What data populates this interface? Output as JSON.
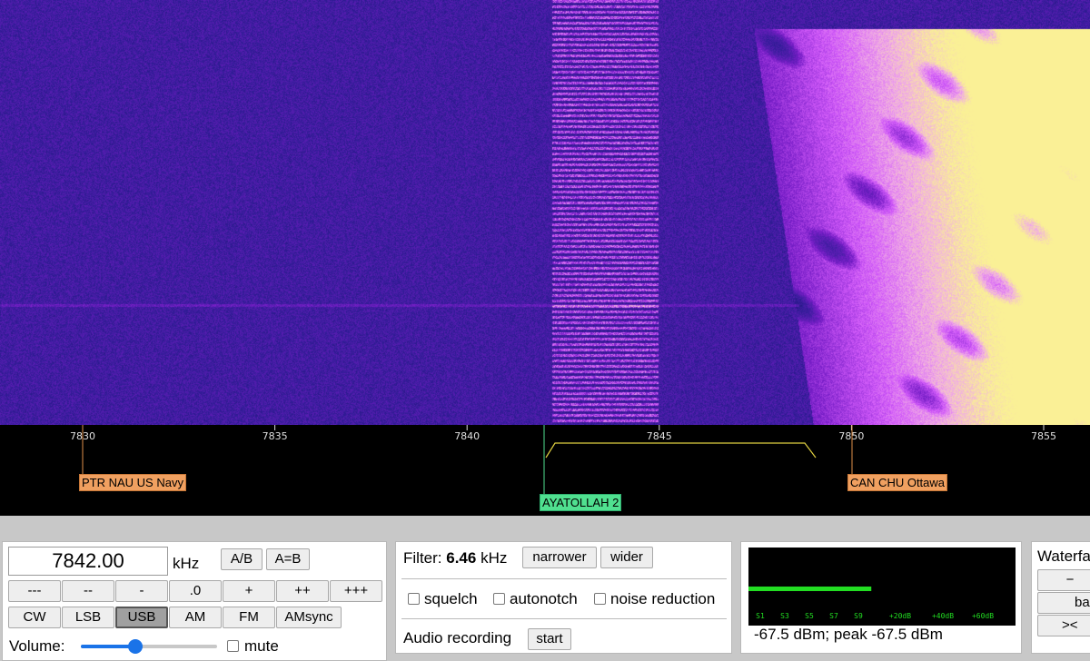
{
  "waterfall": {
    "colors": {
      "noise": "#2a1a8c",
      "signal": "#c040ff",
      "hot": "#f8e880"
    }
  },
  "scale": {
    "ticks": [
      "7830",
      "7835",
      "7840",
      "7845",
      "7850",
      "7855"
    ],
    "passband_color": "#e0d040",
    "stations": [
      {
        "label": "PTR NAU US Navy",
        "color": "#f0a060"
      },
      {
        "label": "AYATOLLAH 2",
        "color": "#50e090"
      },
      {
        "label": "CAN CHU Ottawa",
        "color": "#f0a060"
      }
    ]
  },
  "frequency": {
    "value": "7842.00",
    "unit": "kHz",
    "ab_label": "A/B",
    "aeqb_label": "A=B",
    "step_buttons": [
      "---",
      "--",
      "-",
      ".0",
      "+",
      "++",
      "+++"
    ],
    "modes": [
      "CW",
      "LSB",
      "USB",
      "AM",
      "FM",
      "AMsync"
    ],
    "active_mode": "USB",
    "volume_label": "Volume:",
    "volume_level": 0.4,
    "mute_label": "mute"
  },
  "filter": {
    "label": "Filter:",
    "value": "6.46",
    "unit": "kHz",
    "narrower_label": "narrower",
    "wider_label": "wider",
    "squelch_label": "squelch",
    "autonotch_label": "autonotch",
    "noise_reduction_label": "noise reduction",
    "audio_recording_label": "Audio recording",
    "start_label": "start"
  },
  "smeter": {
    "scale_labels": [
      "S1",
      "S3",
      "S5",
      "S7",
      "S9",
      "+20dB",
      "+40dB",
      "+60dB"
    ],
    "bar_level": 0.46,
    "bar_color": "#22dd22",
    "readout": "-67.5 dBm; peak  -67.5 dBm"
  },
  "waterfall_panel": {
    "title": "Waterfall",
    "minus_label": "−",
    "ba_label": "ba",
    "collapse_label": "><"
  }
}
